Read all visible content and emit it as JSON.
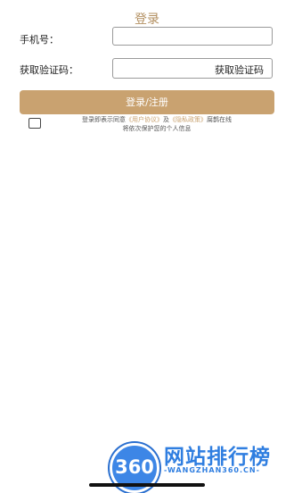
{
  "header": {
    "title": "登录"
  },
  "form": {
    "phone_label": "手机号：",
    "phone_value": "",
    "code_label": "获取验证码：",
    "code_button": "获取验证码",
    "submit_label": "登录/注册"
  },
  "agreement": {
    "prefix": "登录即表示同意",
    "user_agreement": "《用户协议》",
    "and": "及",
    "privacy_policy": "《隐私政策》",
    "suffix": "腐鹊在线",
    "line2": "将依次保护您的个人信息"
  },
  "watermark": {
    "badge": "360",
    "title": "网站排行榜",
    "url": "-WANGZHAN360.CN-"
  },
  "colors": {
    "accent": "#c9a270",
    "title": "#b39062",
    "watermark": "#2f7ee0"
  }
}
